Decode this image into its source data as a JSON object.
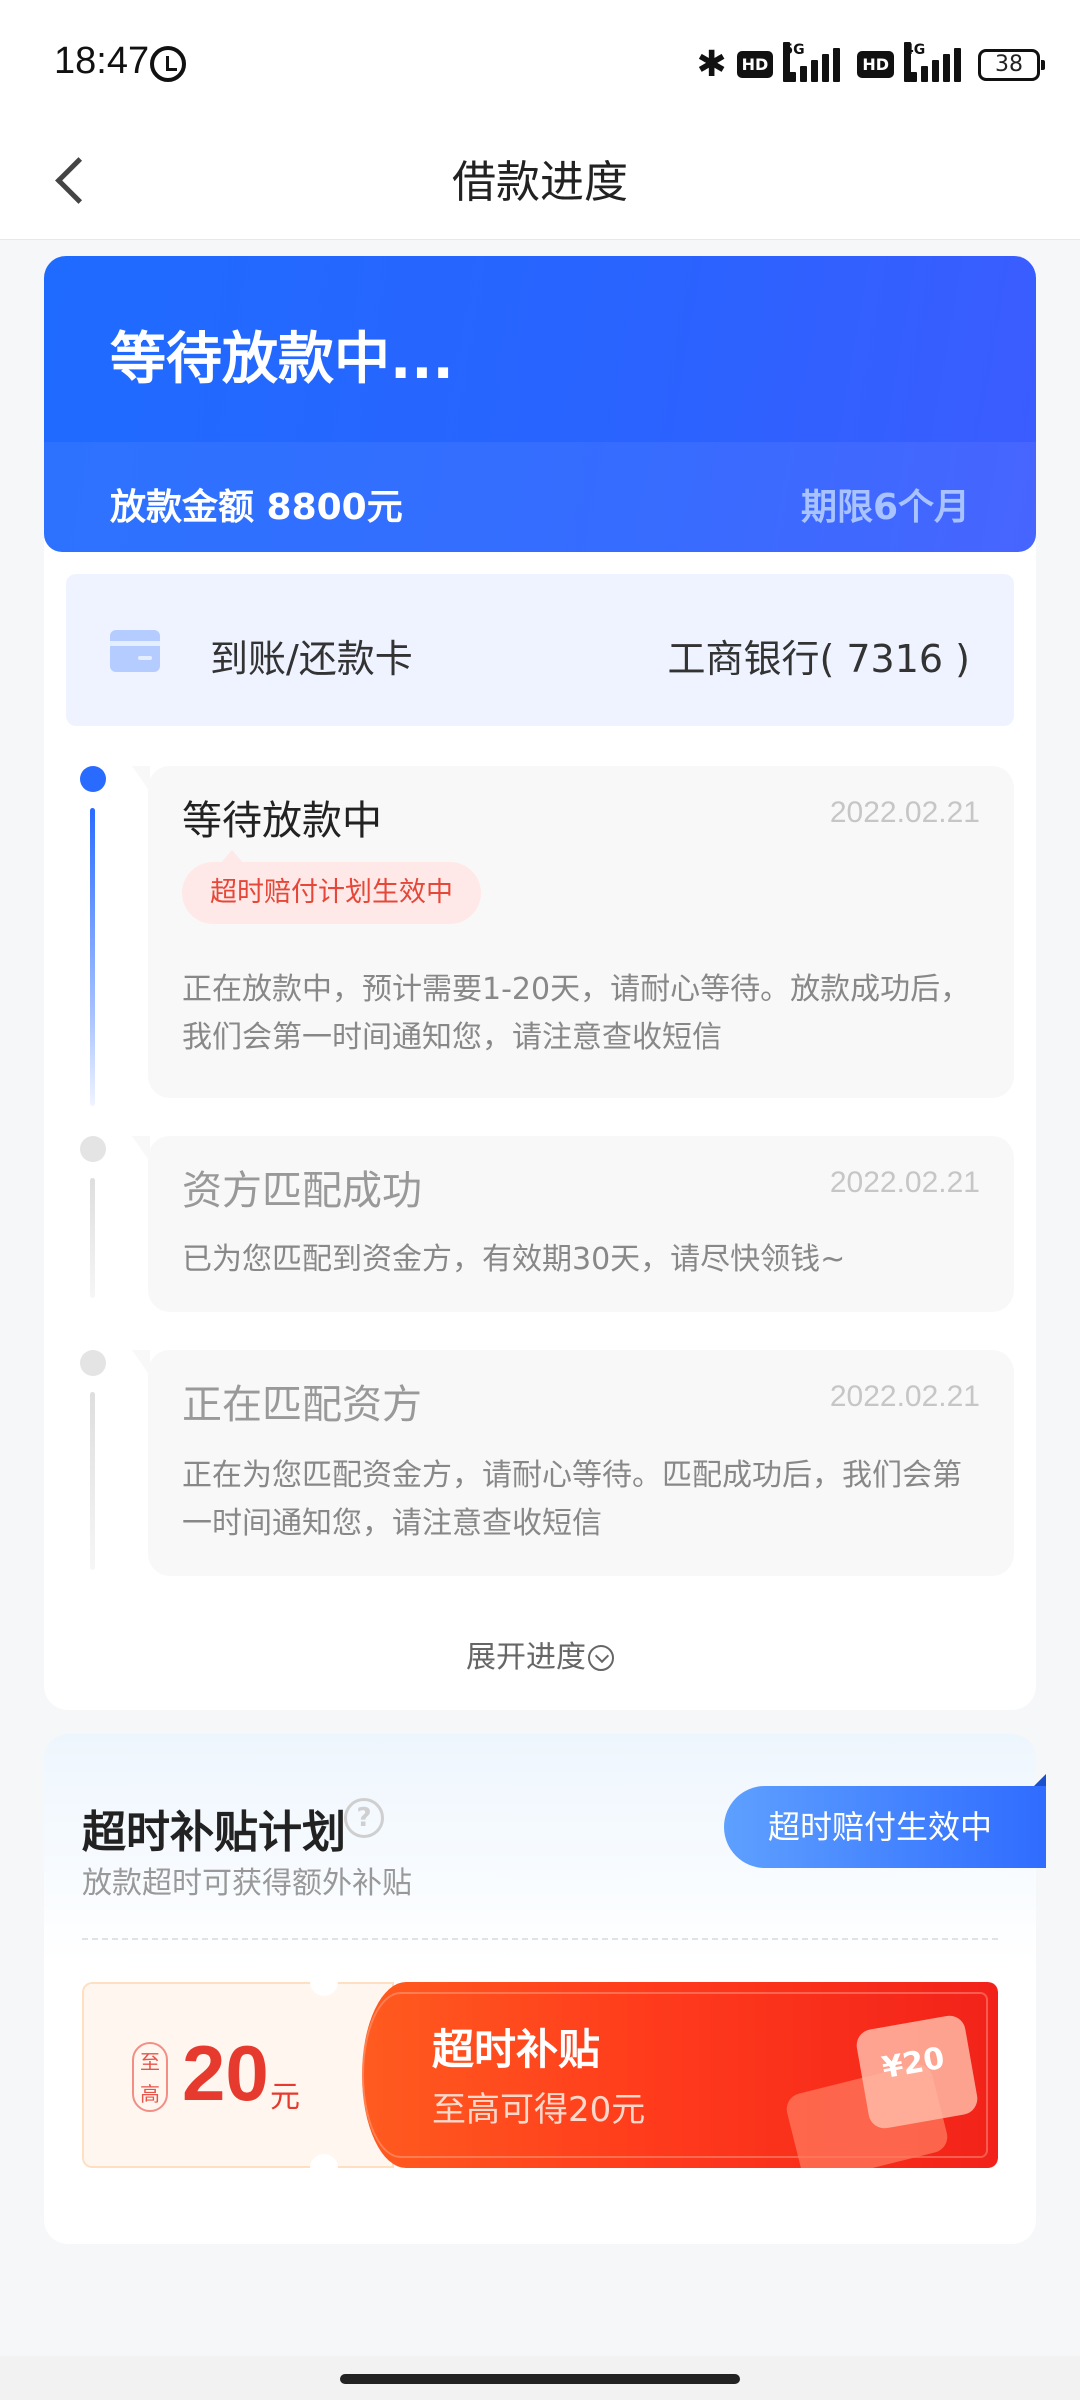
{
  "status_bar": {
    "time": "18:47",
    "bluetooth": "✱",
    "hd_label": "HD",
    "net1": "5G",
    "net2": "4G",
    "battery": "38"
  },
  "nav": {
    "title": "借款进度"
  },
  "loan": {
    "status_title": "等待放款中...",
    "amount_text": "放款金额 8800元",
    "term_text": "期限6个月"
  },
  "bank": {
    "label": "到账/还款卡",
    "value": "工商银行( 7316 )"
  },
  "steps": [
    {
      "title": "等待放款中",
      "date": "2022.02.21",
      "tag": "超时赔付计划生效中",
      "desc_line1": "正在放款中，预计需要1-20天，请耐心等待。放款成功后，",
      "desc_line2": "我们会第一时间通知您，请注意查收短信",
      "active": true
    },
    {
      "title": "资方匹配成功",
      "date": "2022.02.21",
      "desc_line1": "已为您匹配到资金方，有效期30天，请尽快领钱~",
      "active": false
    },
    {
      "title": "正在匹配资方",
      "date": "2022.02.21",
      "desc_line1": "正在为您匹配资金方，请耐心等待。匹配成功后，我们会第",
      "desc_line2": "一时间通知您，请注意查收短信",
      "active": false
    }
  ],
  "expand_label": "展开进度",
  "subsidy": {
    "title": "超时补贴计划",
    "help": "?",
    "subtitle": "放款超时可获得额外补贴",
    "badge": "超时赔付生效中",
    "coupon": {
      "seal": "至高",
      "amount": "20",
      "unit": "元",
      "title": "超时补贴",
      "desc": "至高可得20元",
      "art_text": "¥20"
    }
  },
  "colors": {
    "primary": "#2a63ff",
    "coupon_red": "#e63a2e",
    "tag_red": "#e54838"
  }
}
